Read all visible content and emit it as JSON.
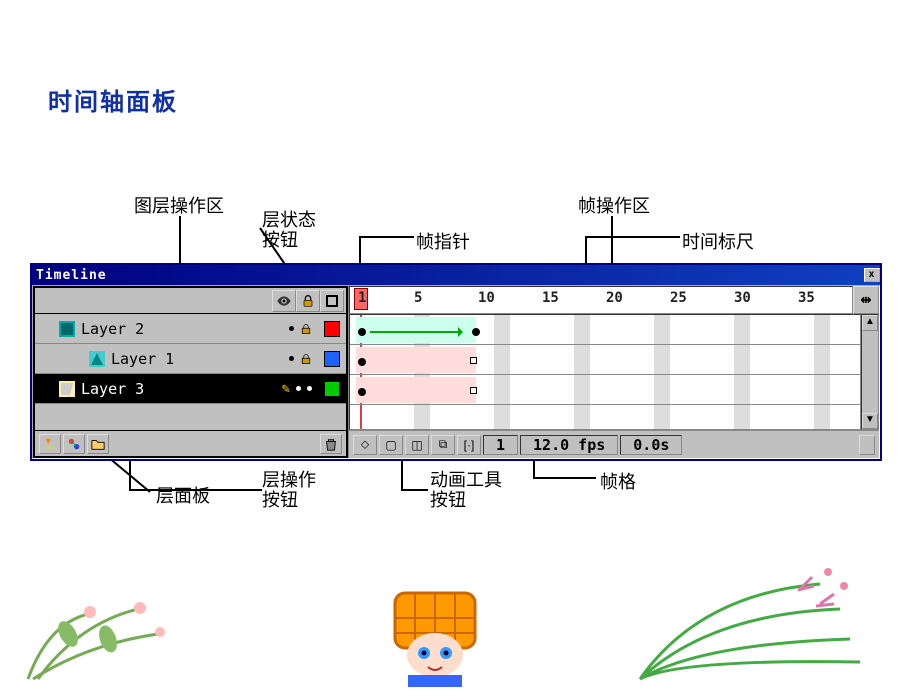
{
  "page_title": "时间轴面板",
  "annotations": {
    "layer_op_area": "图层操作区",
    "layer_state_btn": "层状态\n按钮",
    "frame_op_area": "帧操作区",
    "playhead": "帧指针",
    "time_ruler": "时间标尺",
    "layer_panel": "层面板",
    "layer_op_btn": "层操作\n按钮",
    "anim_tool_btn": "动画工具\n按钮",
    "frame_cell": "帧格"
  },
  "titlebar": {
    "text": "Timeline",
    "close": "x"
  },
  "ruler": {
    "current": "1",
    "marks": [
      "5",
      "10",
      "15",
      "20",
      "25",
      "30",
      "35"
    ]
  },
  "layers": [
    {
      "name": "Layer 2",
      "swatch": "#f00",
      "locked": true,
      "indent": false
    },
    {
      "name": "Layer 1",
      "swatch": "#2060ff",
      "locked": true,
      "indent": true
    },
    {
      "name": "Layer 3",
      "swatch": "#0c0",
      "locked": false,
      "indent": false,
      "selected": true
    }
  ],
  "status": {
    "frame": "1",
    "fps": "12.0 fps",
    "time": "0.0s"
  },
  "right_tool_sym": "⇹",
  "scroll": {
    "up": "▲",
    "down": "▼"
  }
}
